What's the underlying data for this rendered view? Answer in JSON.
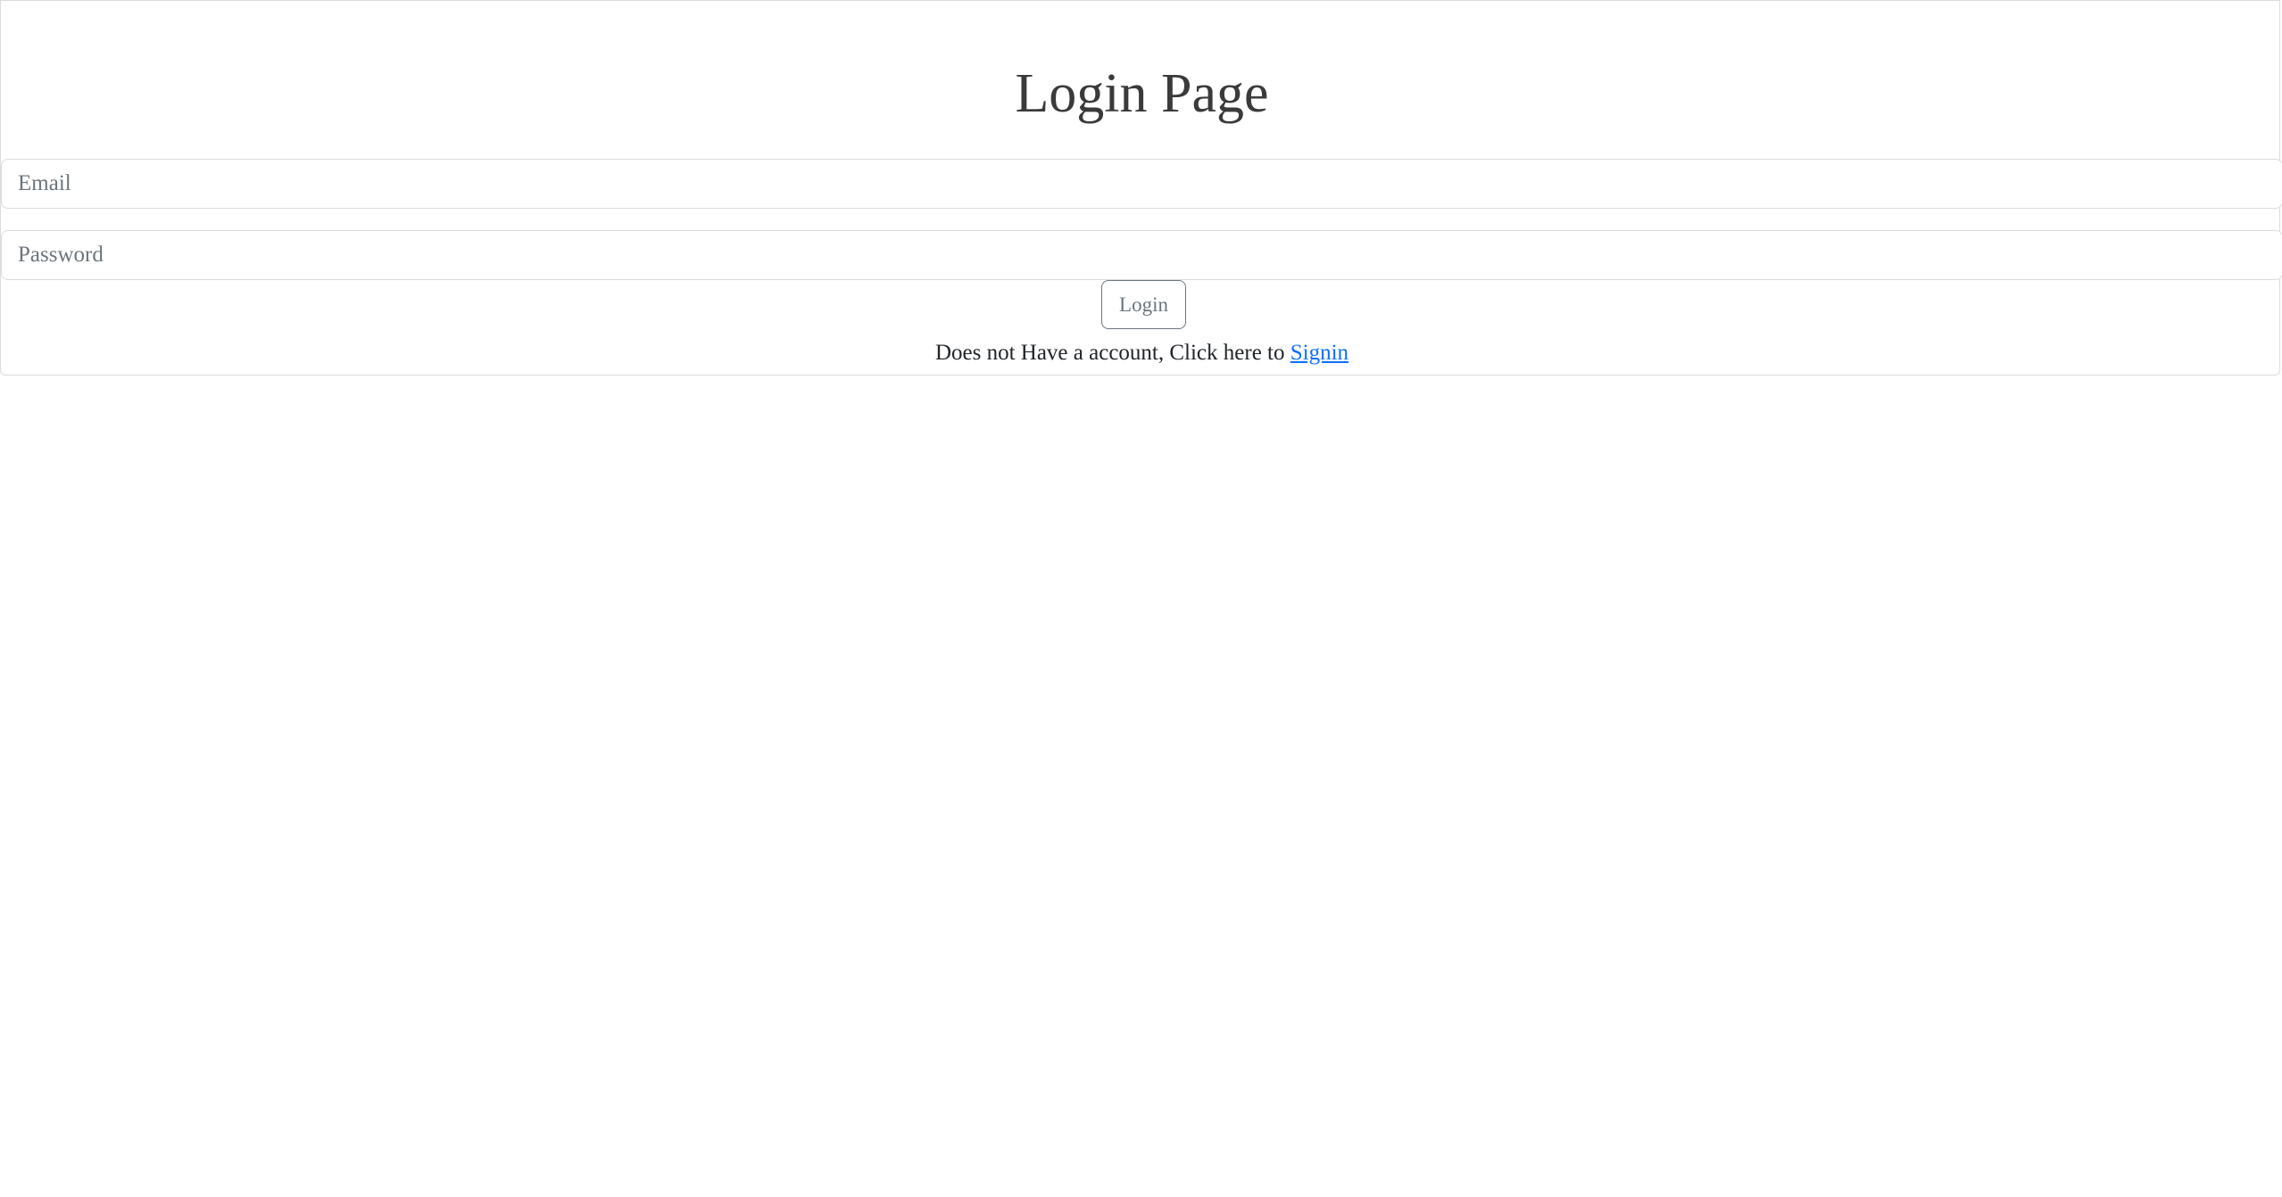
{
  "page": {
    "title": "Login Page"
  },
  "form": {
    "email_placeholder": "Email",
    "password_placeholder": "Password",
    "login_label": "Login",
    "signup_prompt": "Does not Have a account, Click here to",
    "signup_link": "Signin"
  },
  "colors": {
    "link": "#0d6efd",
    "button_outline": "#6c757d",
    "border": "#dcdcdc"
  }
}
